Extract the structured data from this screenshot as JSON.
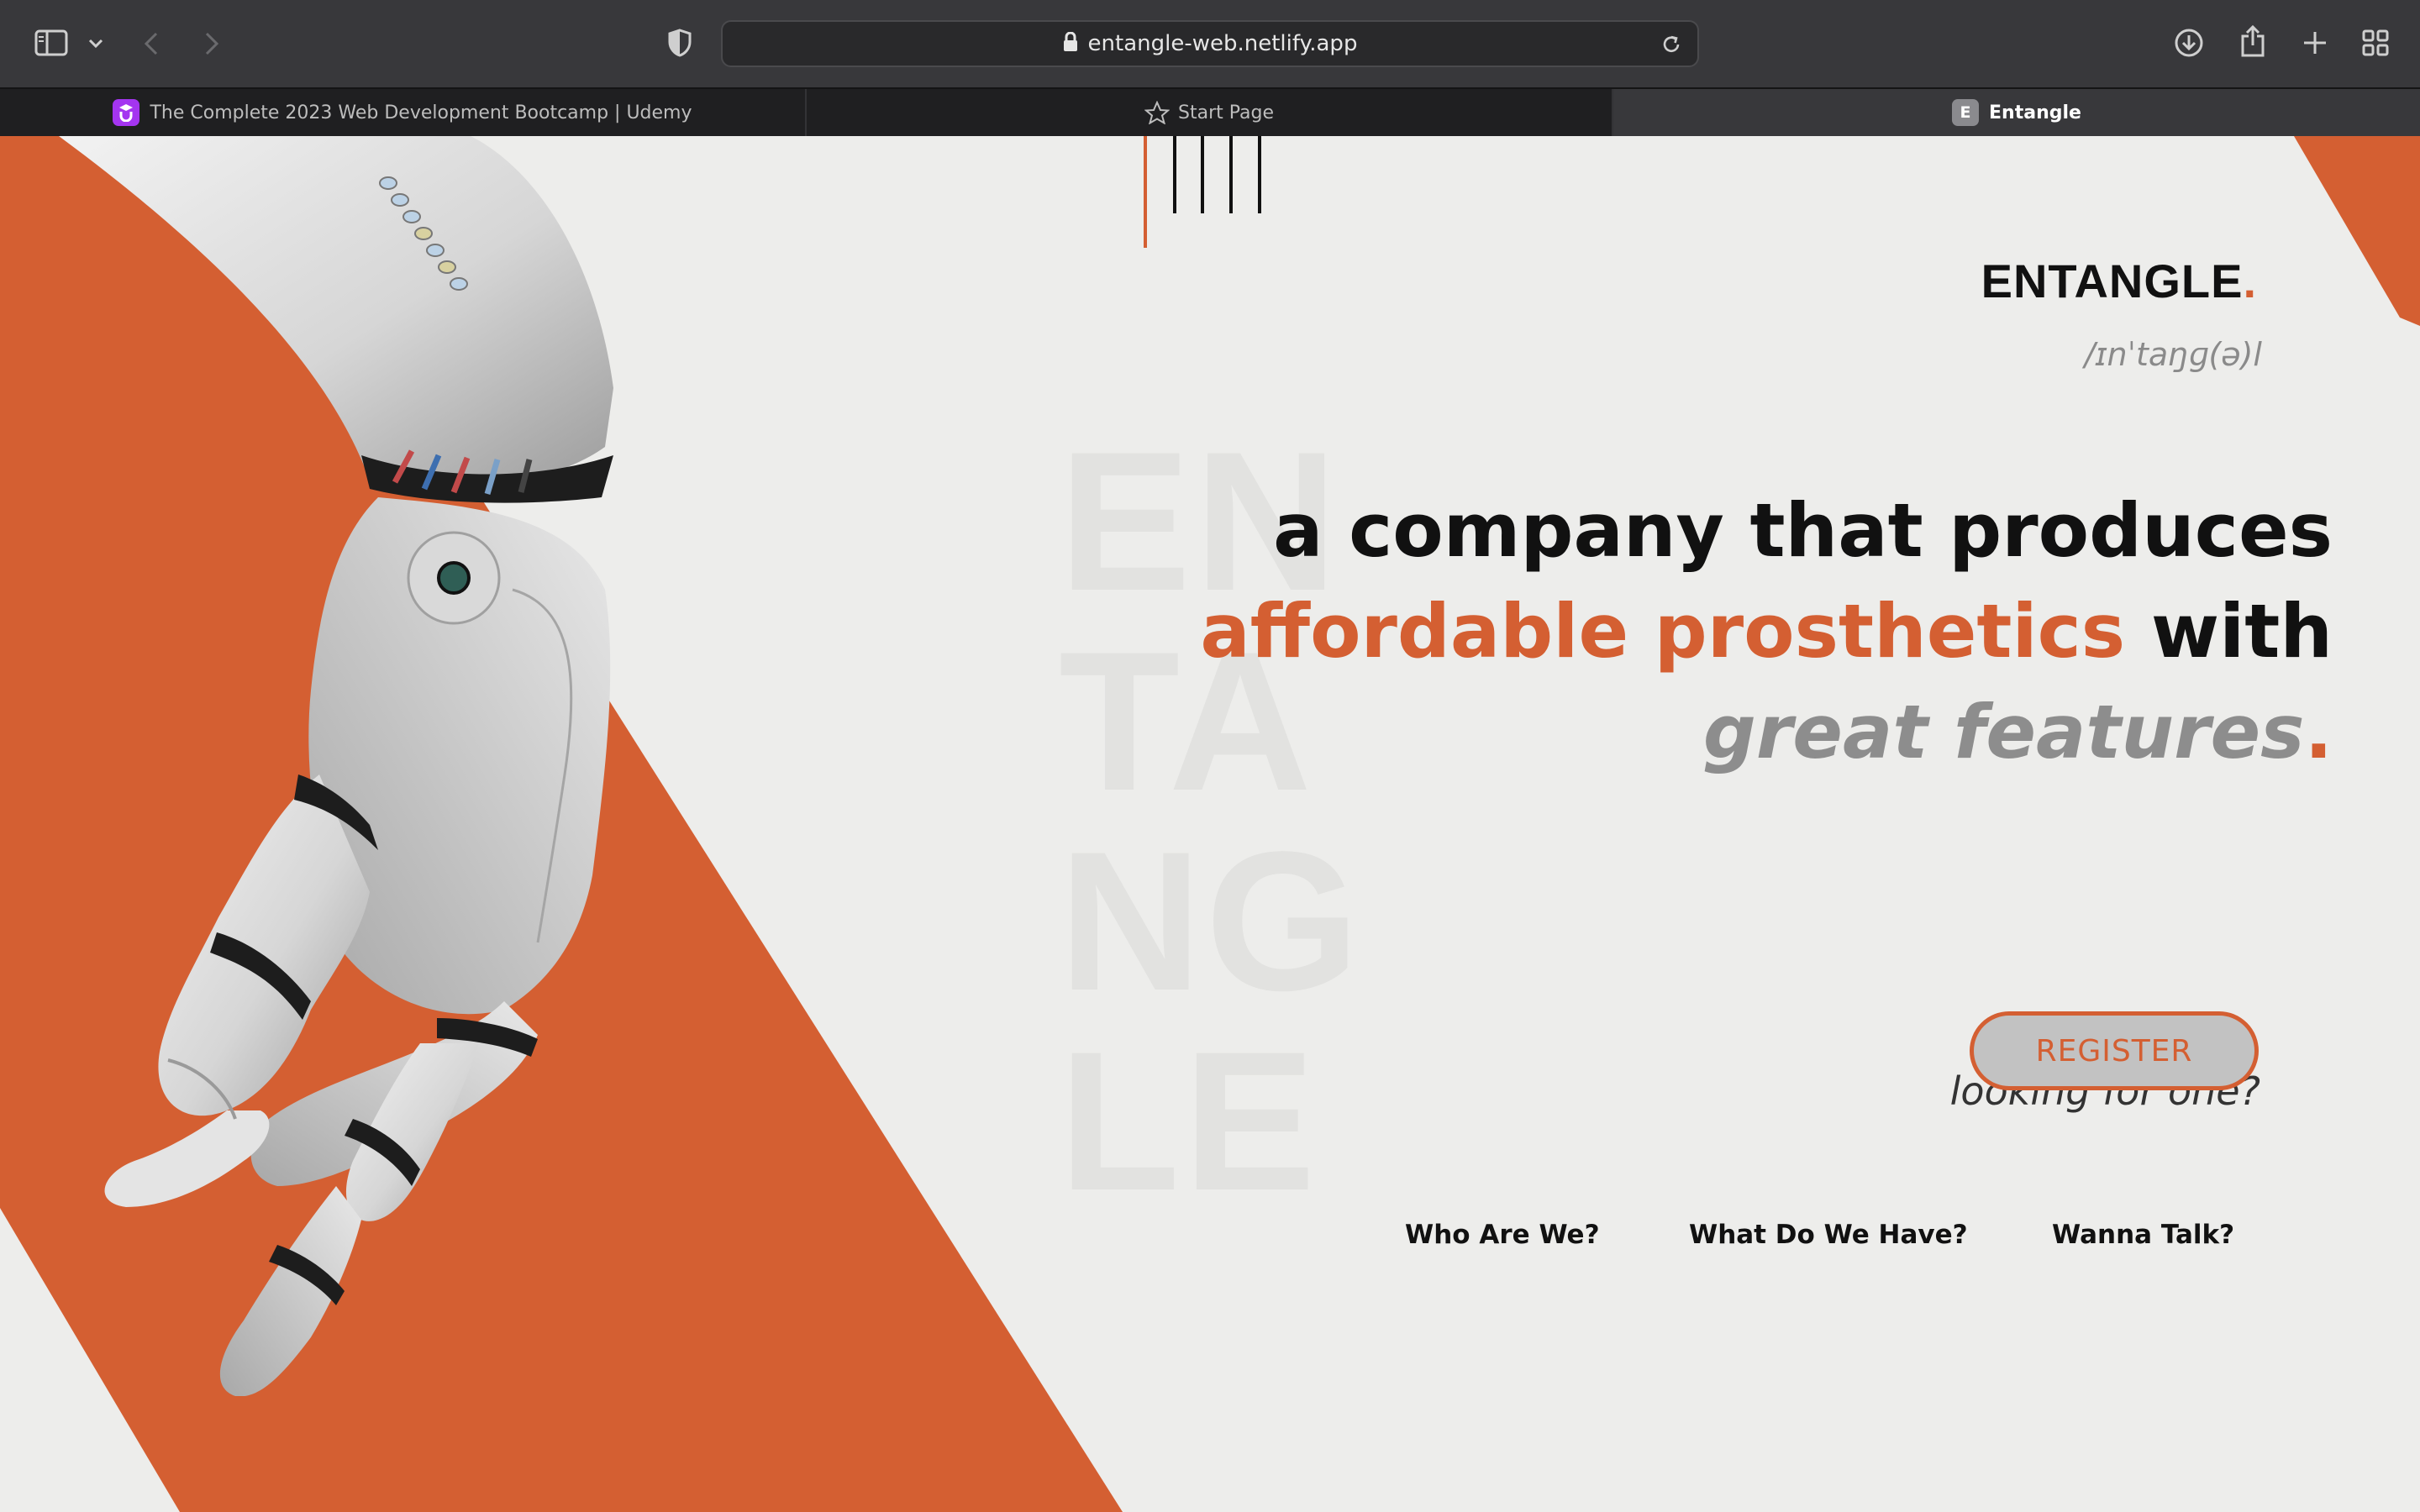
{
  "browser": {
    "url": "entangle-web.netlify.app",
    "tabs": [
      {
        "label": "The Complete 2023 Web Development Bootcamp | Udemy",
        "icon": "udemy-icon"
      },
      {
        "label": "Start Page",
        "icon": "star-icon"
      },
      {
        "label": "Entangle",
        "icon": "entangle-favicon",
        "favicon_letter": "E",
        "active": true
      }
    ]
  },
  "page": {
    "watermark_lines": [
      "EN",
      "TA",
      "NG",
      "LE"
    ],
    "brand": "ENTANGLE",
    "brand_dot": ".",
    "phonetic": "/ɪnˈtaŋɡ(ə)l",
    "headline": {
      "line1": "a company that produces",
      "line2_highlight": "affordable prosthetics",
      "line2_rest": " with",
      "line3": "great features",
      "line3_dot": "."
    },
    "tagline": "looking for one?",
    "register_label": "REGISTER",
    "nav": [
      "Who Are We?",
      "What Do We Have?",
      "Wanna Talk?"
    ],
    "hero_image": "robotic-hand-image"
  },
  "colors": {
    "accent": "#d45f32",
    "background": "#ededeb",
    "chrome": "#38383b"
  }
}
